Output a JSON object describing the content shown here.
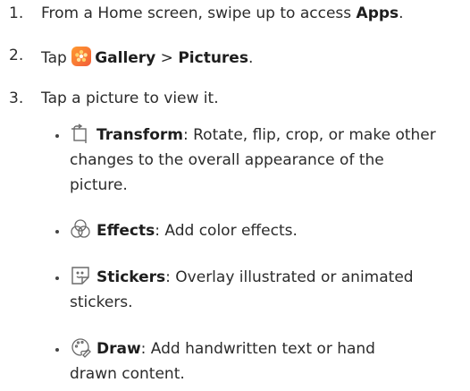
{
  "steps": [
    {
      "num": "1.",
      "text_before": "From a Home screen, swipe up to access ",
      "bold": "Apps",
      "text_after": "."
    },
    {
      "num": "2.",
      "text_before": "Tap ",
      "icon": "gallery-icon",
      "bold1": "Gallery",
      "sep": " > ",
      "bold2": "Pictures",
      "text_after": "."
    },
    {
      "num": "3.",
      "text": "Tap a picture to view it."
    }
  ],
  "tools": [
    {
      "icon": "transform-icon",
      "name": "Transform",
      "desc_line1": ": Rotate, flip, crop, or make other",
      "desc_line2": "changes to the overall appearance of the",
      "desc_line3": "picture."
    },
    {
      "icon": "effects-icon",
      "name": "Effects",
      "desc_line1": ": Add color effects."
    },
    {
      "icon": "stickers-icon",
      "name": "Stickers",
      "desc_line1": ": Overlay illustrated or animated",
      "desc_line2": "stickers."
    },
    {
      "icon": "draw-icon",
      "name": "Draw",
      "desc_line1": ": Add handwritten text or hand",
      "desc_line2": "drawn content."
    }
  ]
}
